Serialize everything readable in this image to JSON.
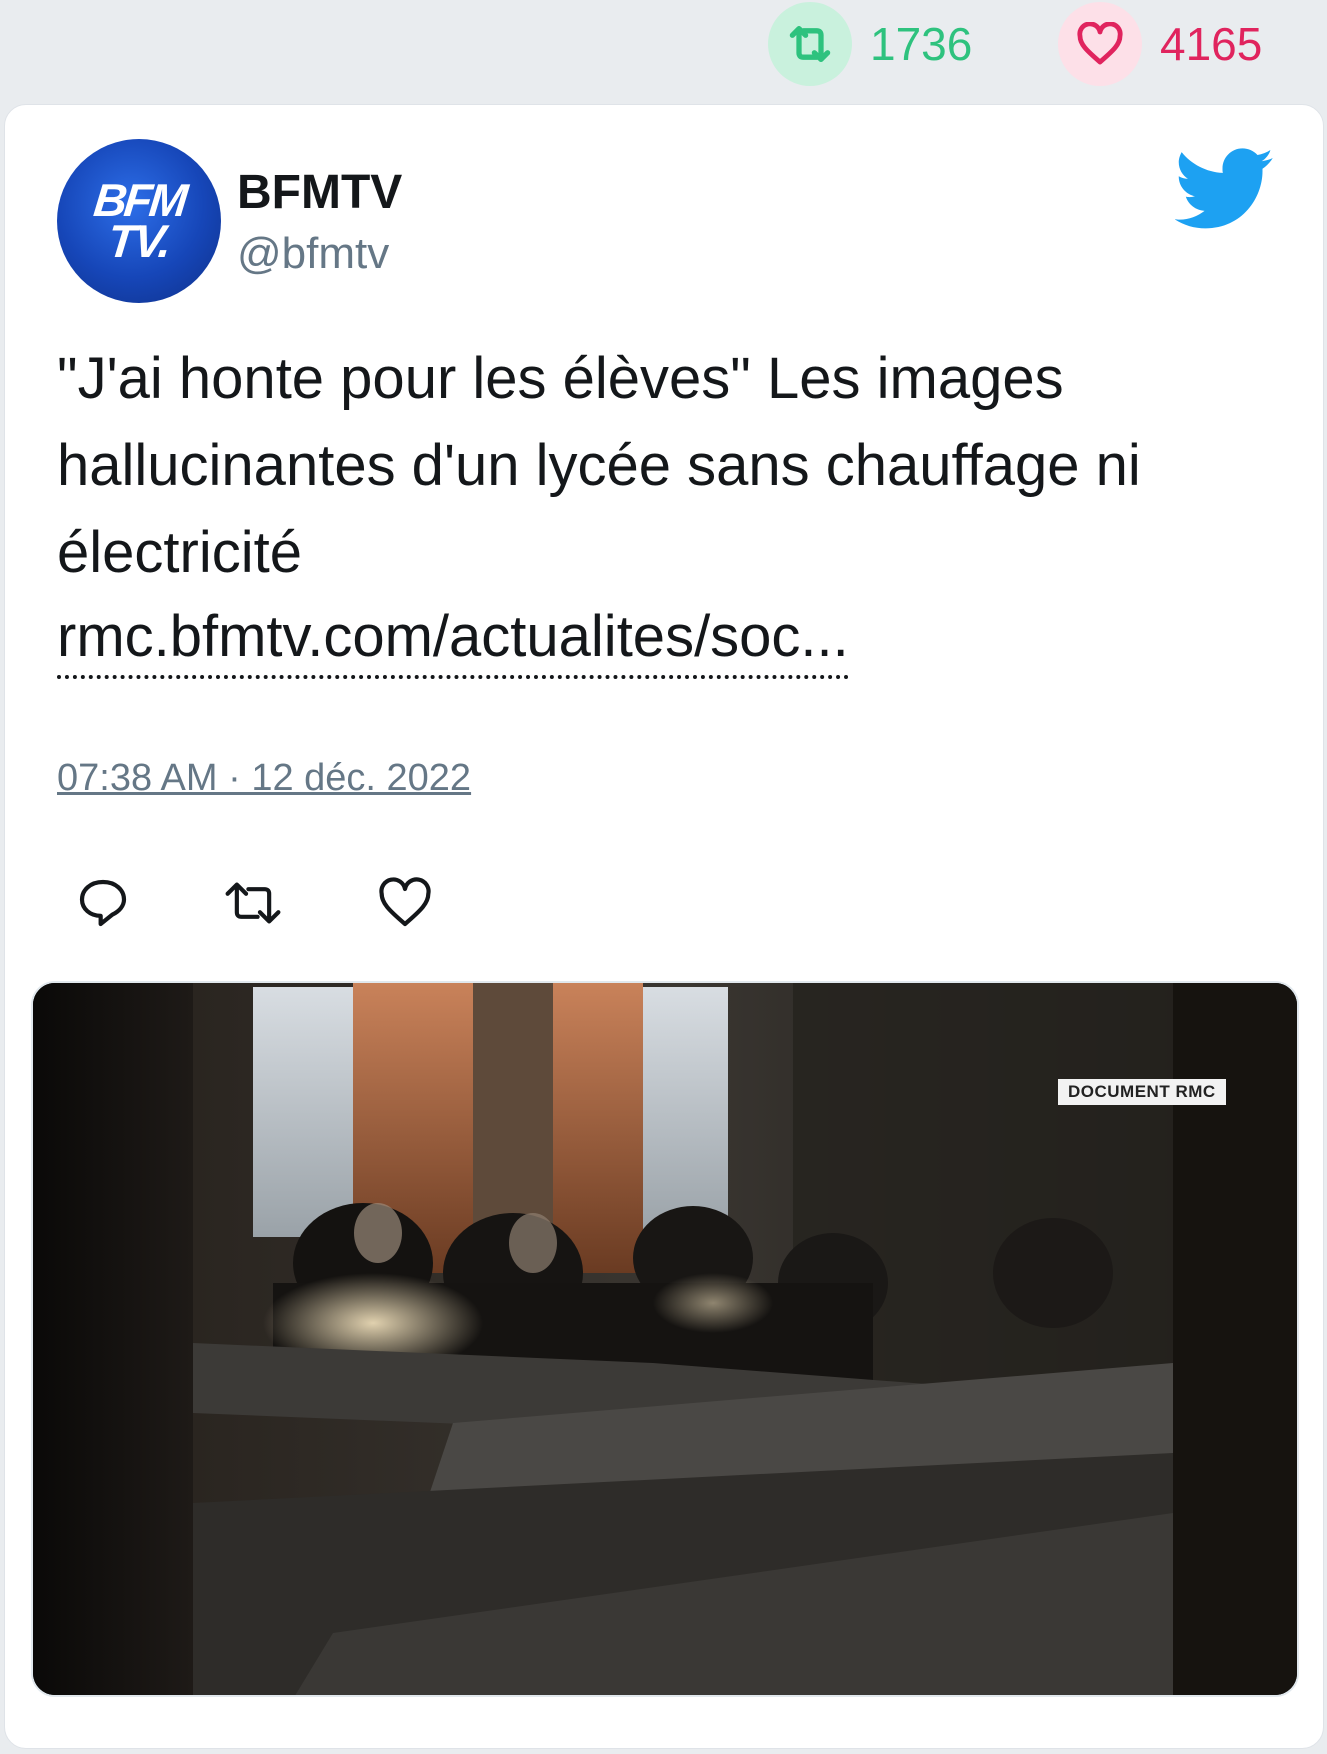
{
  "stats": {
    "retweets": "1736",
    "likes": "4165",
    "retweet_color": "#2ec27e",
    "like_color": "#e0245e",
    "icons": [
      "retweet-icon",
      "heart-icon"
    ]
  },
  "tweet": {
    "author_name": "BFMTV",
    "author_handle": "@bfmtv",
    "avatar_text_line1": "BFM",
    "avatar_text_line2": "TV.",
    "text": "\"J'ai honte pour les élèves\" Les images hallucinantes d'un lycée sans chauffage ni électricité",
    "link": "rmc.bfmtv.com/actualites/soc...",
    "timestamp": "07:38 AM · 12 déc. 2022",
    "brand_icon": "twitter-bird-icon",
    "brand_color": "#1da1f2"
  },
  "actions": {
    "icons": [
      "reply-icon",
      "retweet-icon",
      "like-icon"
    ]
  },
  "media": {
    "badge": "DOCUMENT RMC"
  }
}
